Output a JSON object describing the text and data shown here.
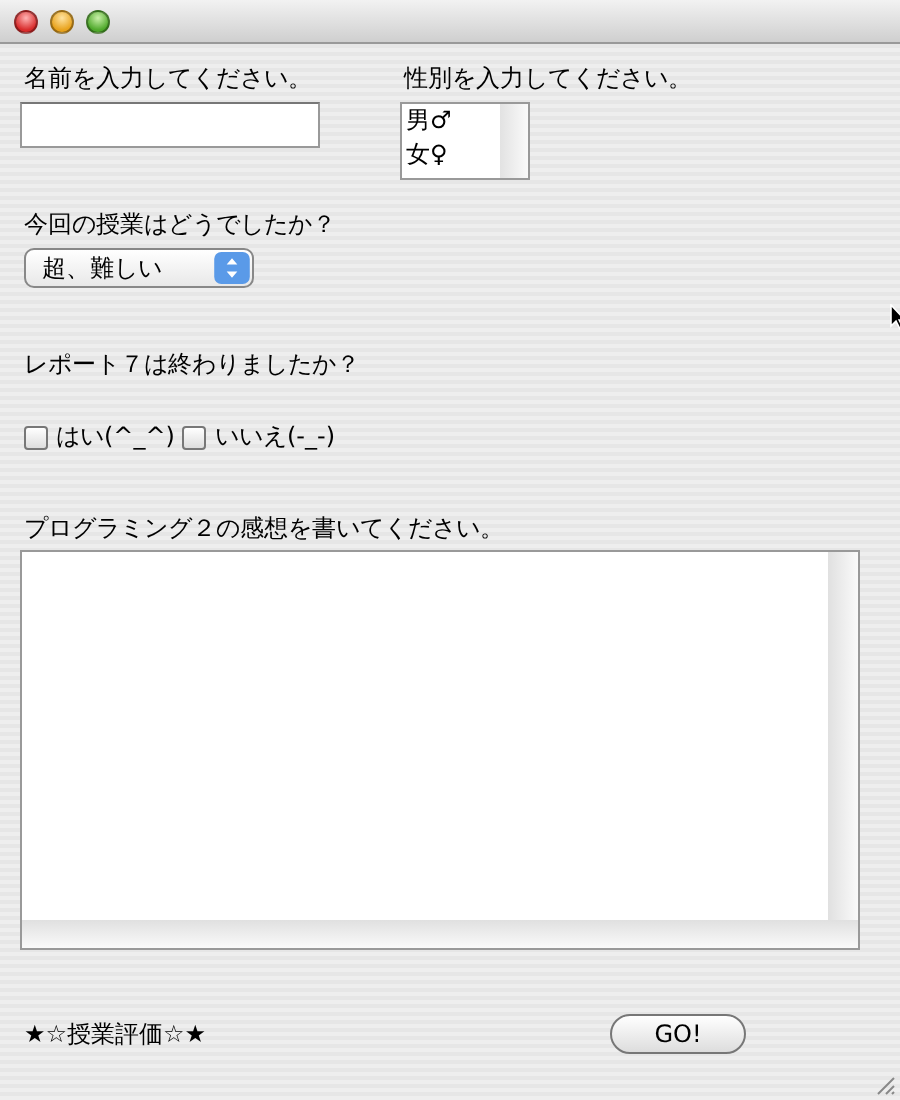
{
  "name": {
    "label": "名前を入力してください。"
  },
  "gender": {
    "label": "性別を入力してください。",
    "options": [
      {
        "label": "男♂",
        "selected": false
      },
      {
        "label": "女♀",
        "selected": false
      }
    ]
  },
  "lesson": {
    "label": "今回の授業はどうでしたか？",
    "value": "超、難しい"
  },
  "report": {
    "label": "レポート７は終わりましたか？",
    "options": [
      {
        "label": "はい(^_^)",
        "checked": false
      },
      {
        "label": "いいえ(-_-)",
        "checked": false
      }
    ]
  },
  "impressions": {
    "label": "プログラミング２の感想を書いてください。"
  },
  "rating": {
    "label": "★☆授業評価☆★"
  },
  "button": {
    "label": "GO!"
  }
}
